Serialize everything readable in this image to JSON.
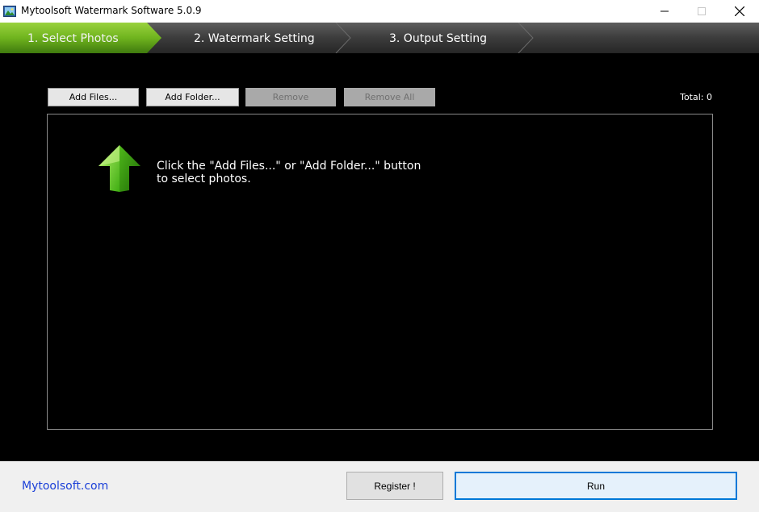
{
  "window": {
    "title": "Mytoolsoft Watermark Software 5.0.9",
    "icon": "landscape-photo-icon",
    "controls": {
      "minimize": "minimize-icon",
      "maximize": "maximize-icon",
      "close": "close-icon"
    }
  },
  "steps": [
    {
      "label": "1. Select Photos",
      "active": true
    },
    {
      "label": "2. Watermark Setting",
      "active": false
    },
    {
      "label": "3. Output Setting",
      "active": false
    }
  ],
  "toolbar": {
    "add_files": "Add Files...",
    "add_folder": "Add Folder...",
    "remove": "Remove",
    "remove_all": "Remove All",
    "total": "Total: 0"
  },
  "photo_list": {
    "hint_icon": "green-up-arrow-icon",
    "hint_line1": "Click the \"Add Files...\" or \"Add Folder...\" button",
    "hint_line2": "to select photos."
  },
  "footer": {
    "site_link": "Mytoolsoft.com",
    "register": "Register !",
    "run": "Run"
  },
  "colors": {
    "active_step": "#6fb41e",
    "link": "#1a3fd8",
    "run_border": "#0078d7"
  }
}
